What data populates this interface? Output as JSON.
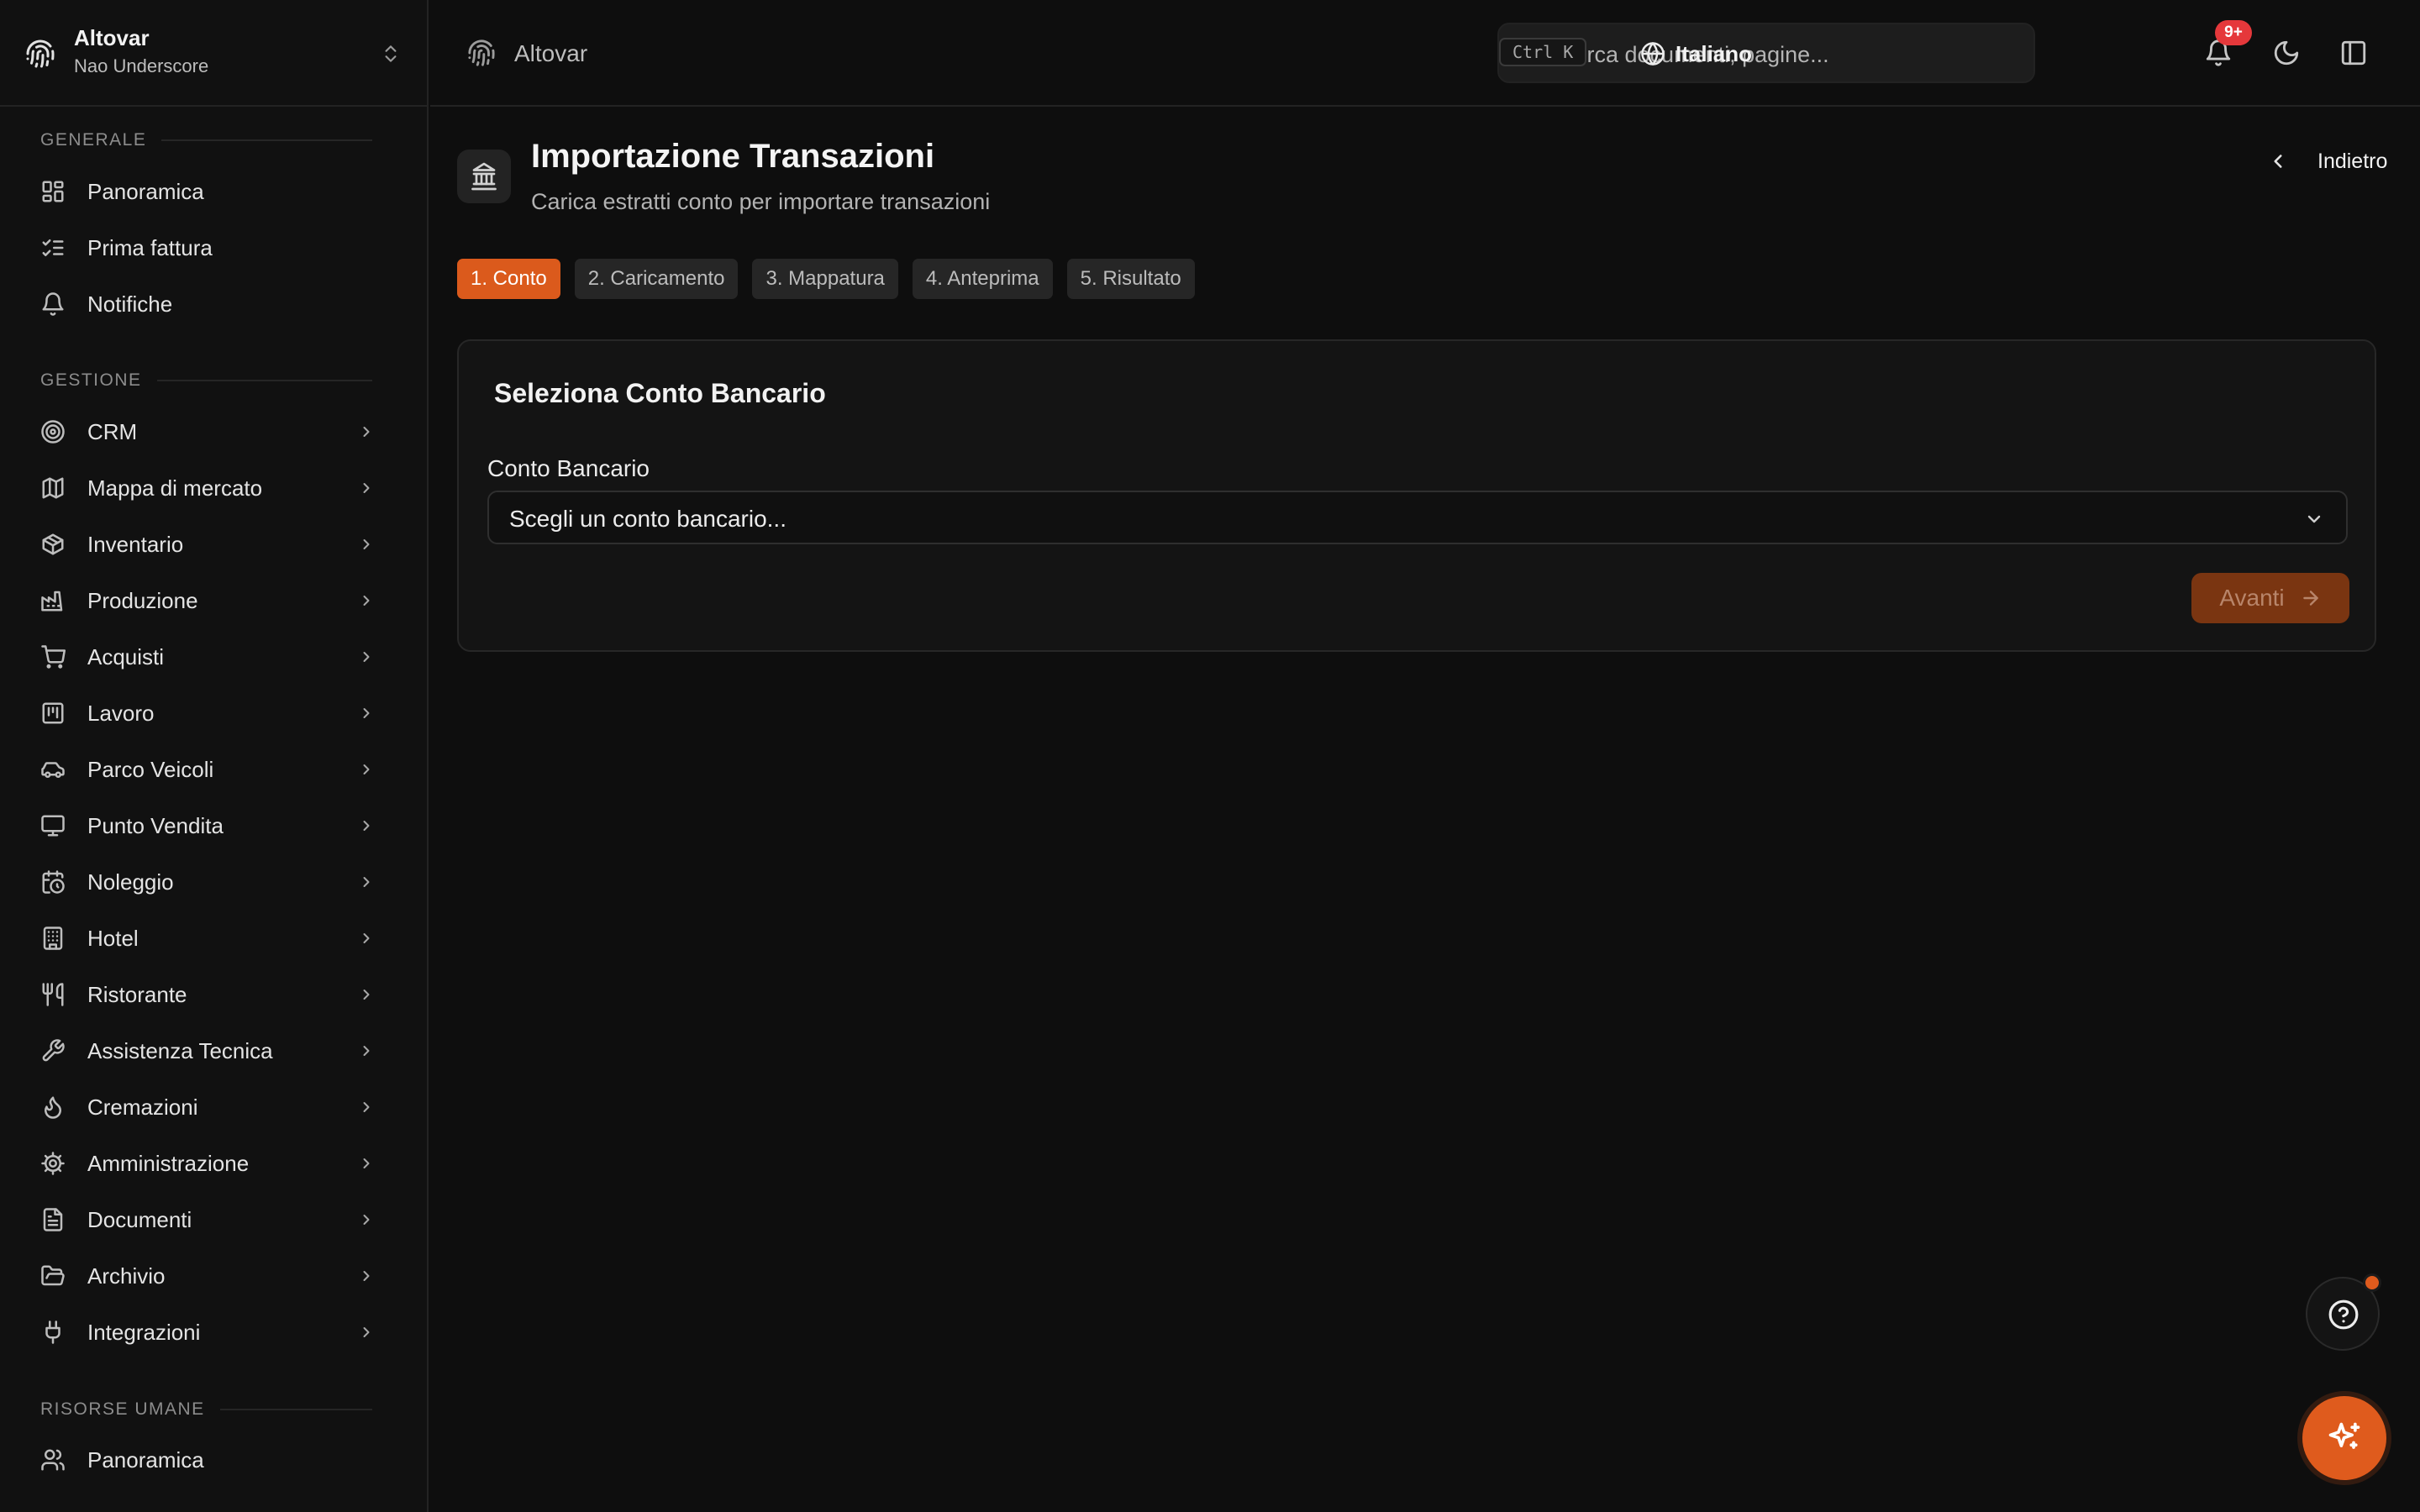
{
  "workspace": {
    "name": "Altovar",
    "user": "Nao Underscore"
  },
  "breadcrumb": {
    "label": "Altovar"
  },
  "search": {
    "placeholder": "Cerca documenti, pagine...",
    "shortcut": "Ctrl K"
  },
  "language": {
    "label": "Italiano"
  },
  "notifications": {
    "badge": "9+"
  },
  "sidebar": {
    "sections": [
      {
        "label": "GENERALE"
      },
      {
        "label": "GESTIONE"
      },
      {
        "label": "RISORSE UMANE"
      }
    ],
    "items": [
      {
        "label": "Panoramica",
        "icon": "dashboard-icon"
      },
      {
        "label": "Prima fattura",
        "icon": "checklist-icon"
      },
      {
        "label": "Notifiche",
        "icon": "bell-icon"
      },
      {
        "label": "CRM",
        "icon": "target-icon"
      },
      {
        "label": "Mappa di mercato",
        "icon": "map-icon"
      },
      {
        "label": "Inventario",
        "icon": "package-icon"
      },
      {
        "label": "Produzione",
        "icon": "factory-icon"
      },
      {
        "label": "Acquisti",
        "icon": "cart-icon"
      },
      {
        "label": "Lavoro",
        "icon": "kanban-icon"
      },
      {
        "label": "Parco Veicoli",
        "icon": "car-icon"
      },
      {
        "label": "Punto Vendita",
        "icon": "monitor-icon"
      },
      {
        "label": "Noleggio",
        "icon": "calendar-clock-icon"
      },
      {
        "label": "Hotel",
        "icon": "building-icon"
      },
      {
        "label": "Ristorante",
        "icon": "utensils-icon"
      },
      {
        "label": "Assistenza Tecnica",
        "icon": "wrench-icon"
      },
      {
        "label": "Cremazioni",
        "icon": "flame-icon"
      },
      {
        "label": "Amministrazione",
        "icon": "gear-icon"
      },
      {
        "label": "Documenti",
        "icon": "file-icon"
      },
      {
        "label": "Archivio",
        "icon": "folder-open-icon"
      },
      {
        "label": "Integrazioni",
        "icon": "plug-icon"
      },
      {
        "label": "Panoramica",
        "icon": "users-icon"
      }
    ]
  },
  "page": {
    "title": "Importazione Transazioni",
    "subtitle": "Carica estratti conto per importare transazioni",
    "back_label": "Indietro",
    "icon": "bank-icon"
  },
  "steps": [
    {
      "label": "1. Conto",
      "active": true
    },
    {
      "label": "2. Caricamento",
      "active": false
    },
    {
      "label": "3. Mappatura",
      "active": false
    },
    {
      "label": "4. Anteprima",
      "active": false
    },
    {
      "label": "5. Risultato",
      "active": false
    }
  ],
  "card": {
    "title": "Seleziona Conto Bancario",
    "field_label": "Conto Bancario",
    "select_value": "Scegli un conto bancario...",
    "next_label": "Avanti"
  },
  "colors": {
    "accent": "#db5a1c",
    "background": "#0e0e0e",
    "sidebar": "#111111",
    "badge": "#e5383b"
  }
}
